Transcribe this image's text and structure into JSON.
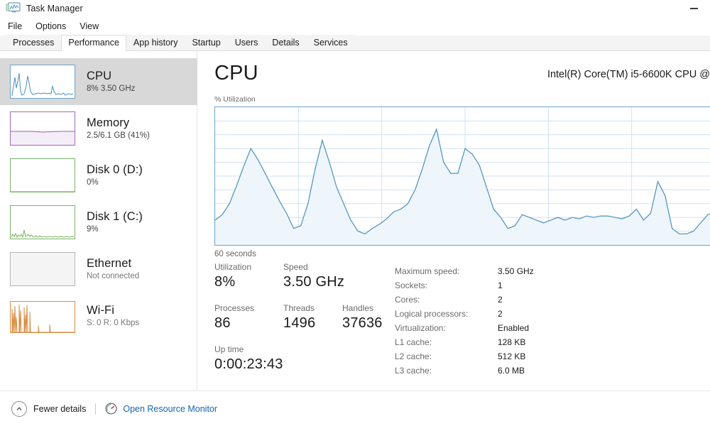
{
  "window": {
    "title": "Task Manager",
    "icon": "task-manager-icon",
    "minimize_label": "—"
  },
  "menu": {
    "items": [
      {
        "label": "File"
      },
      {
        "label": "Options"
      },
      {
        "label": "View"
      }
    ]
  },
  "tabs": {
    "active": "Performance",
    "items": [
      {
        "label": "Processes"
      },
      {
        "label": "Performance"
      },
      {
        "label": "App history"
      },
      {
        "label": "Startup"
      },
      {
        "label": "Users"
      },
      {
        "label": "Details"
      },
      {
        "label": "Services"
      }
    ]
  },
  "sidebar": {
    "items": [
      {
        "title": "CPU",
        "subtitle": "8%  3.50 GHz",
        "selected": true,
        "color": "#4a8fbd"
      },
      {
        "title": "Memory",
        "subtitle": "2.5/6.1 GB (41%)",
        "selected": false,
        "color": "#9b59b6"
      },
      {
        "title": "Disk 0 (D:)",
        "subtitle": "0%",
        "selected": false,
        "color": "#77b255"
      },
      {
        "title": "Disk 1 (C:)",
        "subtitle": "9%",
        "selected": false,
        "color": "#77b255"
      },
      {
        "title": "Ethernet",
        "subtitle": "Not connected",
        "selected": false,
        "color": "#b0b0b0"
      },
      {
        "title": "Wi-Fi",
        "subtitle": "S: 0 R: 0 Kbps",
        "selected": false,
        "color": "#d98c3f"
      }
    ]
  },
  "main": {
    "heading": "CPU",
    "cpu_name": "Intel(R) Core(TM) i5-6600K CPU @",
    "graph_caption": "% Utilization",
    "graph_footer": "60 seconds",
    "accent_color": "#4a8fbd",
    "grid_color": "#cfe2f0",
    "fill_color": "#eef5fb"
  },
  "stats": {
    "primary": [
      {
        "label": "Utilization",
        "value": "8%"
      },
      {
        "label": "Speed",
        "value": "3.50 GHz"
      },
      {
        "label": "Processes",
        "value": "86"
      },
      {
        "label": "Threads",
        "value": "1496"
      },
      {
        "label": "Handles",
        "value": "37636"
      },
      {
        "label": "Up time",
        "value": "0:00:23:43"
      }
    ],
    "details": [
      {
        "label": "Maximum speed:",
        "value": "3.50 GHz"
      },
      {
        "label": "Sockets:",
        "value": "1"
      },
      {
        "label": "Cores:",
        "value": "2"
      },
      {
        "label": "Logical processors:",
        "value": "2"
      },
      {
        "label": "Virtualization:",
        "value": "Enabled"
      },
      {
        "label": "L1 cache:",
        "value": "128 KB"
      },
      {
        "label": "L2 cache:",
        "value": "512 KB"
      },
      {
        "label": "L3 cache:",
        "value": "6.0 MB"
      }
    ]
  },
  "footer": {
    "fewer_details": "Fewer details",
    "open_resource_monitor": "Open Resource Monitor",
    "link_color": "#1464b4"
  },
  "chart_data": {
    "type": "area",
    "title": "% Utilization",
    "xlabel": "60 seconds",
    "ylabel": "% Utilization",
    "ylim": [
      0,
      100
    ],
    "xlim": [
      0,
      60
    ],
    "grid": true,
    "grid_rows": 10,
    "grid_cols": 6,
    "legend": "none",
    "series": [
      {
        "name": "CPU utilization",
        "color": "#4a8fbd",
        "values": [
          18,
          22,
          30,
          43,
          57,
          70,
          62,
          52,
          42,
          32,
          23,
          12,
          14,
          30,
          55,
          76,
          60,
          42,
          30,
          18,
          10,
          8,
          12,
          15,
          19,
          24,
          26,
          30,
          40,
          55,
          72,
          84,
          60,
          52,
          52,
          70,
          66,
          58,
          42,
          26,
          20,
          12,
          14,
          22,
          20,
          18,
          16,
          18,
          20,
          18,
          20,
          19,
          21,
          20,
          21,
          21,
          20,
          19,
          21,
          26,
          18,
          23,
          46,
          36,
          12,
          8,
          8,
          10,
          16,
          22,
          24
        ]
      }
    ]
  }
}
